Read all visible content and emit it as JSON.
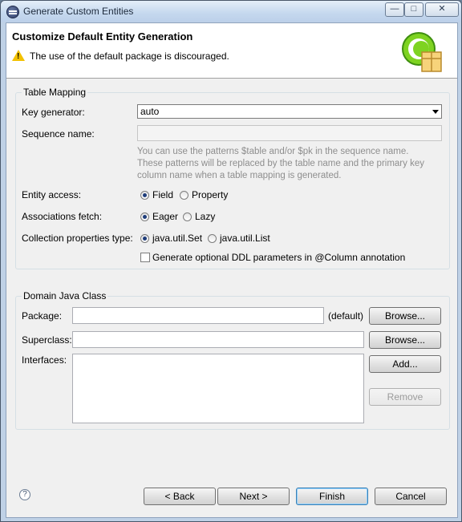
{
  "window": {
    "title": "Generate Custom Entities",
    "controls": {
      "minimize": "—",
      "maximize": "□",
      "close": "✕"
    }
  },
  "header": {
    "title": "Customize Default Entity Generation",
    "message": "The use of the default package is discouraged."
  },
  "table_mapping": {
    "group_label": "Table Mapping",
    "key_generator_label": "Key generator:",
    "key_generator_value": "auto",
    "sequence_name_label": "Sequence name:",
    "sequence_name_value": "",
    "hint_line1": "You can use the patterns $table and/or $pk in the sequence name.",
    "hint_line2": "These patterns will be replaced by the table name and the primary key",
    "hint_line3": "column name when a table mapping is generated.",
    "entity_access_label": "Entity access:",
    "entity_access_options": [
      "Field",
      "Property"
    ],
    "entity_access_selected": "Field",
    "associations_fetch_label": "Associations fetch:",
    "associations_fetch_options": [
      "Eager",
      "Lazy"
    ],
    "associations_fetch_selected": "Eager",
    "collection_type_label": "Collection properties type:",
    "collection_type_options": [
      "java.util.Set",
      "java.util.List"
    ],
    "collection_type_selected": "java.util.Set",
    "ddl_checkbox_label": "Generate optional DDL parameters in @Column annotation",
    "ddl_checked": false
  },
  "domain_class": {
    "group_label": "Domain Java Class",
    "package_label": "Package:",
    "package_value": "",
    "package_default": "(default)",
    "browse_label": "Browse...",
    "superclass_label": "Superclass:",
    "superclass_value": "",
    "interfaces_label": "Interfaces:",
    "add_label": "Add...",
    "remove_label": "Remove"
  },
  "footer": {
    "help_icon": "?",
    "back_label": "< Back",
    "next_label": "Next >",
    "finish_label": "Finish",
    "cancel_label": "Cancel"
  },
  "colors": {
    "accent": "#3c7fb1",
    "radio_dot": "#1f3d7a",
    "warning": "#f2c100"
  }
}
